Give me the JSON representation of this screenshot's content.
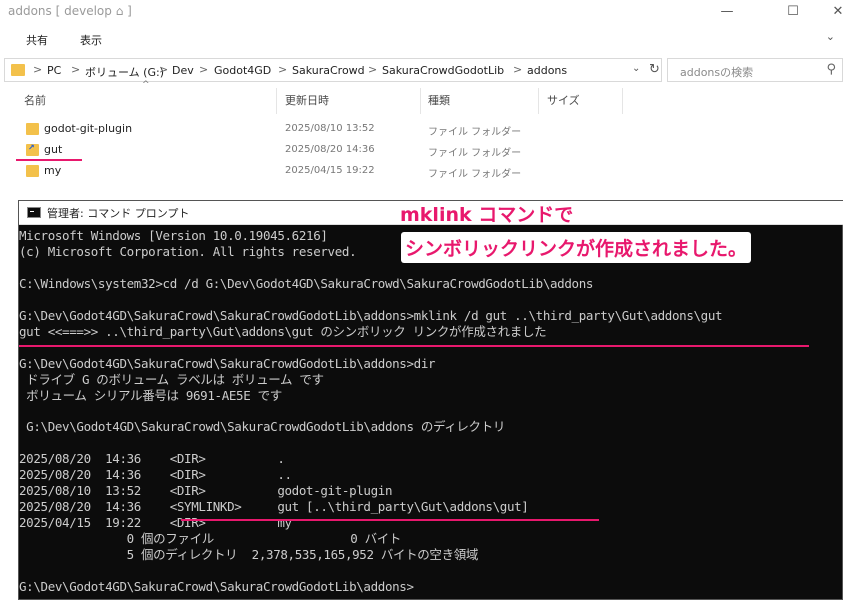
{
  "window": {
    "title": "addons [ develop ⌂ ]",
    "minimize_icon": "minimize-icon",
    "maximize_icon": "maximize-icon",
    "close_icon": "close-icon"
  },
  "ribbon": {
    "tabs": [
      "共有",
      "表示"
    ],
    "expand_icon": "chevron-down-icon"
  },
  "address": {
    "crumbs": [
      "PC",
      "ボリューム (G:)",
      "Dev",
      "Godot4GD",
      "SakuraCrowd",
      "SakuraCrowdGodotLib",
      "addons"
    ],
    "separator": ">",
    "search_placeholder": "addonsの検索"
  },
  "columns": [
    "名前",
    "更新日時",
    "種類",
    "サイズ"
  ],
  "files": [
    {
      "name": "godot-git-plugin",
      "date": "2025/08/10 13:52",
      "type": "ファイル フォルダー"
    },
    {
      "name": "gut",
      "date": "2025/08/20 14:36",
      "type": "ファイル フォルダー"
    },
    {
      "name": "my",
      "date": "2025/04/15 19:22",
      "type": "ファイル フォルダー"
    }
  ],
  "cmd": {
    "title": "管理者: コマンド プロンプト",
    "lines": [
      "Microsoft Windows [Version 10.0.19045.6216]",
      "(c) Microsoft Corporation. All rights reserved.",
      "",
      "C:\\Windows\\system32>cd /d G:\\Dev\\Godot4GD\\SakuraCrowd\\SakuraCrowdGodotLib\\addons",
      "",
      "G:\\Dev\\Godot4GD\\SakuraCrowd\\SakuraCrowdGodotLib\\addons>mklink /d gut ..\\third_party\\Gut\\addons\\gut",
      "gut <<===>> ..\\third_party\\Gut\\addons\\gut のシンボリック リンクが作成されました",
      "",
      "G:\\Dev\\Godot4GD\\SakuraCrowd\\SakuraCrowdGodotLib\\addons>dir",
      " ドライブ G のボリューム ラベルは ボリューム です",
      " ボリューム シリアル番号は 9691-AE5E です",
      "",
      " G:\\Dev\\Godot4GD\\SakuraCrowd\\SakuraCrowdGodotLib\\addons のディレクトリ",
      "",
      "2025/08/20  14:36    <DIR>          .",
      "2025/08/20  14:36    <DIR>          ..",
      "2025/08/10  13:52    <DIR>          godot-git-plugin",
      "2025/08/20  14:36    <SYMLINKD>     gut [..\\third_party\\Gut\\addons\\gut]",
      "2025/04/15  19:22    <DIR>          my",
      "               0 個のファイル                   0 バイト",
      "               5 個のディレクトリ  2,378,535,165,952 バイトの空き領域",
      "",
      "G:\\Dev\\Godot4GD\\SakuraCrowd\\SakuraCrowdGodotLib\\addons>"
    ]
  },
  "annotation": {
    "line1": "mklink コマンドで",
    "line2": "シンボリックリンクが作成されました。",
    "color": "#e8186d"
  }
}
